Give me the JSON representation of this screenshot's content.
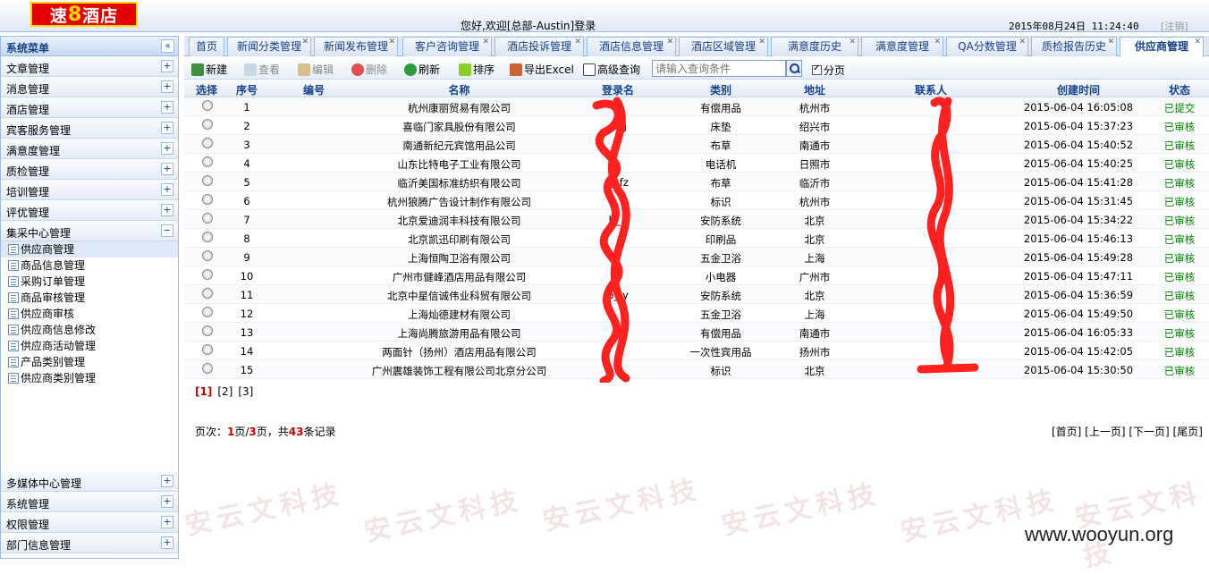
{
  "header": {
    "logo": {
      "part1": "速",
      "part2": "8",
      "part3": "酒店"
    },
    "welcome": "您好,欢迎[总部-Austin]登录",
    "datetime": "2015年08月24日 11:24:40",
    "logout": "[注销]"
  },
  "sidebar": {
    "title": "系统菜单",
    "collapse_icon": "«",
    "groups_top": [
      {
        "label": "文章管理",
        "toggle": "+"
      },
      {
        "label": "消息管理",
        "toggle": "+"
      },
      {
        "label": "酒店管理",
        "toggle": "+"
      },
      {
        "label": "宾客服务管理",
        "toggle": "+"
      },
      {
        "label": "满意度管理",
        "toggle": "+"
      },
      {
        "label": "质检管理",
        "toggle": "+"
      },
      {
        "label": "培训管理",
        "toggle": "+"
      },
      {
        "label": "评优管理",
        "toggle": "+"
      },
      {
        "label": "集采中心管理",
        "toggle": "−"
      }
    ],
    "sub_items": [
      "供应商管理",
      "商品信息管理",
      "采购订单管理",
      "商品审核管理",
      "供应商审核",
      "供应商信息修改",
      "供应商活动管理",
      "产品类别管理",
      "供应商类别管理"
    ],
    "groups_bottom": [
      {
        "label": "多媒体中心管理",
        "toggle": "+"
      },
      {
        "label": "系统管理",
        "toggle": "+"
      },
      {
        "label": "权限管理",
        "toggle": "+"
      },
      {
        "label": "部门信息管理",
        "toggle": "+"
      }
    ]
  },
  "tabs": [
    {
      "label": "首页",
      "closable": false
    },
    {
      "label": "新闻分类管理",
      "closable": true
    },
    {
      "label": "新闻发布管理",
      "closable": true
    },
    {
      "label": "客户咨询管理",
      "closable": true
    },
    {
      "label": "酒店投诉管理",
      "closable": true
    },
    {
      "label": "酒店信息管理",
      "closable": true
    },
    {
      "label": "酒店区域管理",
      "closable": true
    },
    {
      "label": "满意度历史",
      "closable": true
    },
    {
      "label": "满意度管理",
      "closable": true
    },
    {
      "label": "QA分数管理",
      "closable": true
    },
    {
      "label": "质检报告历史",
      "closable": true
    },
    {
      "label": "供应商管理",
      "closable": true,
      "active": true
    }
  ],
  "toolbar": {
    "new": "新建",
    "view": "查看",
    "edit": "编辑",
    "delete": "删除",
    "refresh": "刷新",
    "sort": "排序",
    "export": "导出Excel",
    "advanced": "高级查询",
    "search_placeholder": "请输入查询条件",
    "paging": "分页"
  },
  "grid": {
    "columns": [
      "选择",
      "序号",
      "编号",
      "名称",
      "登录名",
      "类别",
      "地址",
      "联系人",
      "创建时间",
      "状态"
    ],
    "rows": [
      {
        "no": "1",
        "name": "杭州康丽贸易有限公司",
        "login": "",
        "category": "有偿用品",
        "address": "杭州市",
        "time": "2015-06-04 16:05:08",
        "status": "已提交"
      },
      {
        "no": "2",
        "name": "喜临门家具股份有限公司",
        "login": "sx   j",
        "category": "床垫",
        "address": "绍兴市",
        "time": "2015-06-04 15:37:23",
        "status": "已审核"
      },
      {
        "no": "3",
        "name": "南通新纪元宾馆用品公司",
        "login": "",
        "category": "布草",
        "address": "南通市",
        "time": "2015-06-04 15:40:52",
        "status": "已审核"
      },
      {
        "no": "4",
        "name": "山东比特电子工业有限公司",
        "login": "",
        "category": "电话机",
        "address": "日照市",
        "time": "2015-06-04 15:40:25",
        "status": "已审核"
      },
      {
        "no": "5",
        "name": "临沂美国标准纺织有限公司",
        "login": "ly    fz",
        "category": "布草",
        "address": "临沂市",
        "time": "2015-06-04 15:41:28",
        "status": "已审核"
      },
      {
        "no": "6",
        "name": "杭州狼腾广告设计制作有限公司",
        "login": "",
        "category": "标识",
        "address": "杭州市",
        "time": "2015-06-04 15:31:45",
        "status": "已审核"
      },
      {
        "no": "7",
        "name": "北京爱迪润丰科技有限公司",
        "login": "b_   f",
        "category": "安防系统",
        "address": "北京",
        "time": "2015-06-04 15:34:22",
        "status": "已审核"
      },
      {
        "no": "8",
        "name": "北京凯迅印刷有限公司",
        "login": "",
        "category": "印刷品",
        "address": "北京",
        "time": "2015-06-04 15:46:13",
        "status": "已审核"
      },
      {
        "no": "9",
        "name": "上海恒陶卫浴有限公司",
        "login": "",
        "category": "五金卫浴",
        "address": "上海",
        "time": "2015-06-04 15:49:28",
        "status": "已审核"
      },
      {
        "no": "10",
        "name": "广州市健峰酒店用品有限公司",
        "login": "",
        "category": "小电器",
        "address": "广州市",
        "time": "2015-06-04 15:47:11",
        "status": "已审核"
      },
      {
        "no": "11",
        "name": "北京中星信诚伟业科贸有限公司",
        "login": "b_    y",
        "category": "安防系统",
        "address": "北京",
        "time": "2015-06-04 15:36:59",
        "status": "已审核"
      },
      {
        "no": "12",
        "name": "上海灿德建材有限公司",
        "login": "",
        "category": "五金卫浴",
        "address": "上海",
        "time": "2015-06-04 15:49:50",
        "status": "已审核"
      },
      {
        "no": "13",
        "name": "上海尚腾旅游用品有限公司",
        "login": "",
        "category": "有偿用品",
        "address": "南通市",
        "time": "2015-06-04 16:05:33",
        "status": "已审核"
      },
      {
        "no": "14",
        "name": "两面针（扬州）酒店用品有限公司",
        "login": "",
        "category": "一次性宾用品",
        "address": "扬州市",
        "time": "2015-06-04 15:42:05",
        "status": "已审核"
      },
      {
        "no": "15",
        "name": "广州震雄装饰工程有限公司北京分公司",
        "login": "",
        "category": "标识",
        "address": "北京",
        "time": "2015-06-04 15:30:50",
        "status": "已审核"
      }
    ]
  },
  "pagination": {
    "pages": [
      "[1]",
      "[2]",
      "[3]"
    ],
    "summary_prefix": "页次：",
    "current": "1",
    "sep": "页/",
    "total_pages": "3",
    "mid": "页，共",
    "records": "43",
    "suffix": "条记录",
    "nav": "[首页] [上一页] [下一页] [尾页]"
  },
  "watermark": "安云文科技",
  "site": "www.wooyun.org",
  "colors": {
    "status_green": "#008800",
    "accent": "#15428b",
    "redact": "#ff2020",
    "logo_red": "#e40000"
  }
}
